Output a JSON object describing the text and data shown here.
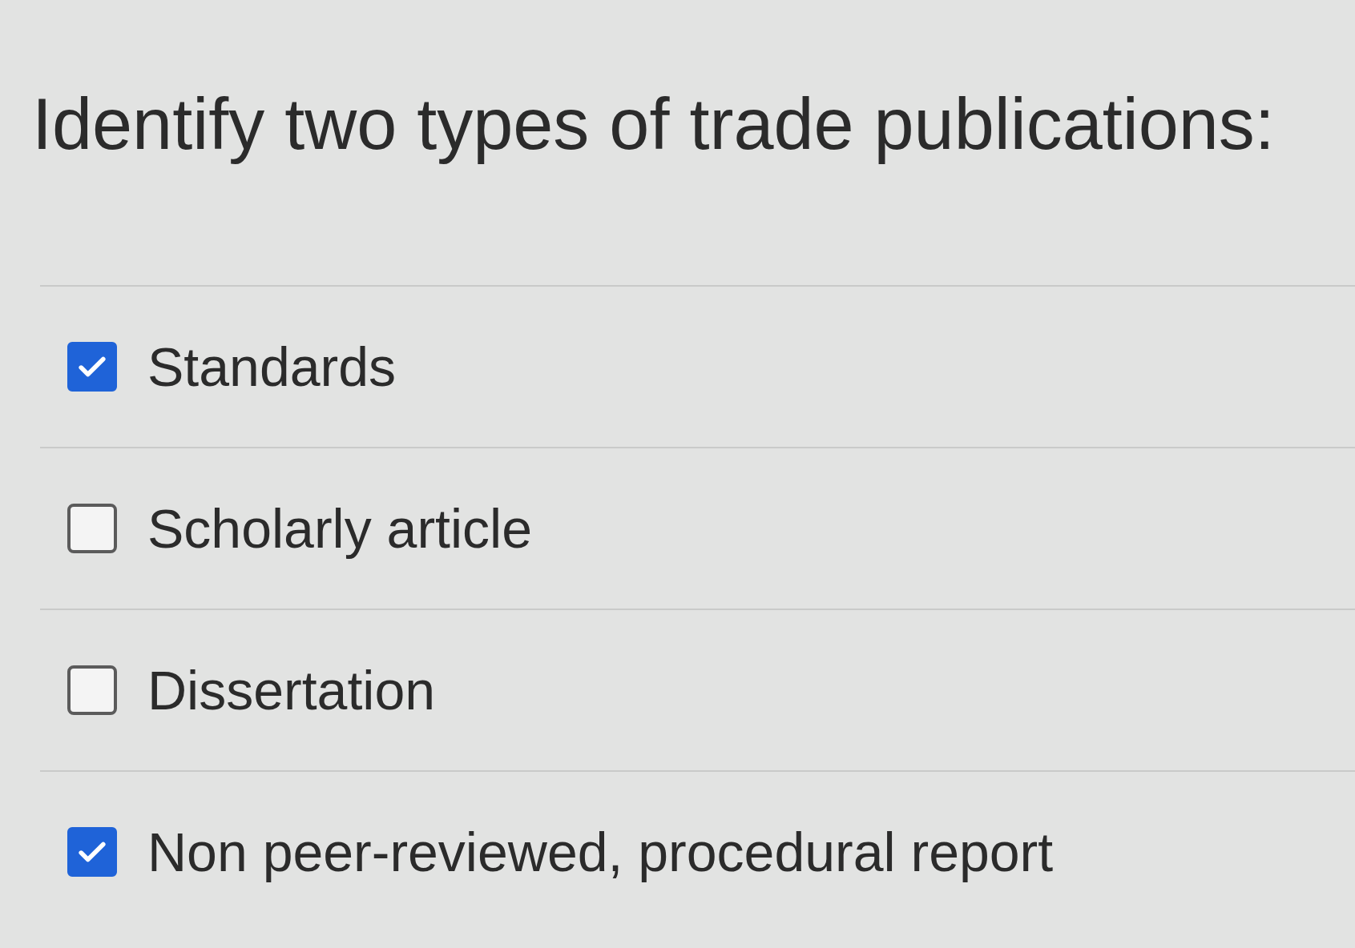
{
  "question": {
    "text": "Identify two types of trade publications:"
  },
  "options": [
    {
      "label": "Standards",
      "checked": true
    },
    {
      "label": "Scholarly article",
      "checked": false
    },
    {
      "label": "Dissertation",
      "checked": false
    },
    {
      "label": "Non peer-reviewed, procedural report",
      "checked": true
    }
  ]
}
